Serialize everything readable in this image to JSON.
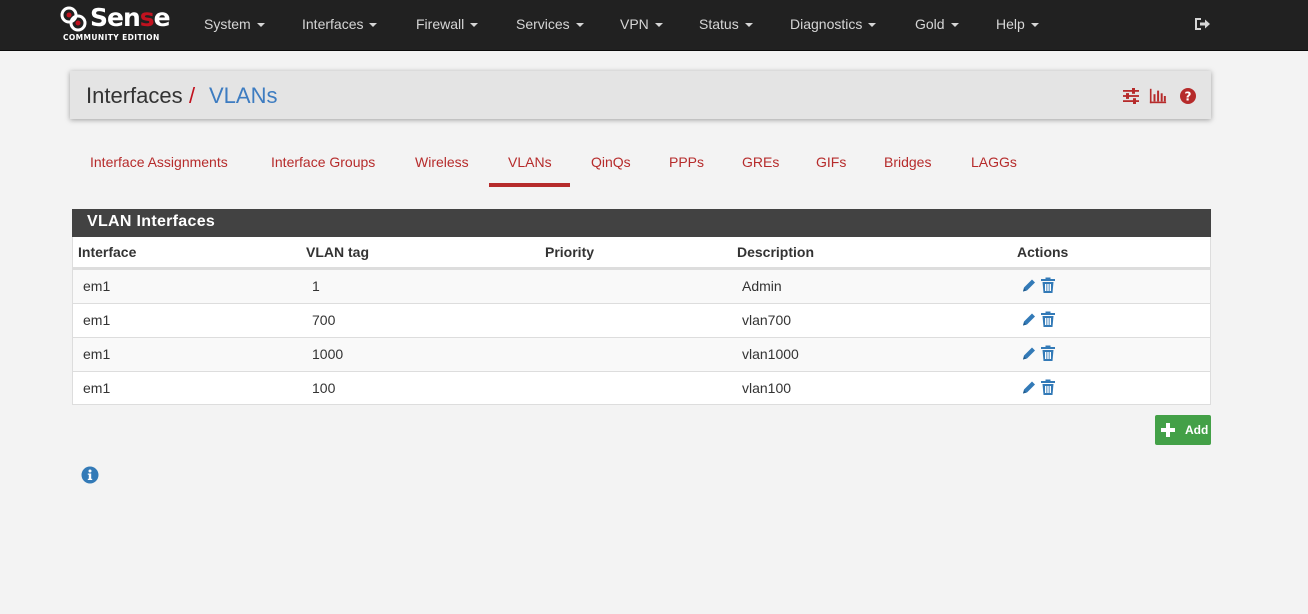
{
  "brand": {
    "name_prefix": "pf",
    "name_part1": "Sen",
    "name_part2": "s",
    "name_part3": "e",
    "edition": "COMMUNITY EDITION"
  },
  "nav": {
    "items": [
      {
        "label": "System"
      },
      {
        "label": "Interfaces"
      },
      {
        "label": "Firewall"
      },
      {
        "label": "Services"
      },
      {
        "label": "VPN"
      },
      {
        "label": "Status"
      },
      {
        "label": "Diagnostics"
      },
      {
        "label": "Gold"
      },
      {
        "label": "Help"
      }
    ],
    "logout_icon": "sign-out-icon"
  },
  "breadcrumb": {
    "root": "Interfaces",
    "separator": "/",
    "current": "VLANs"
  },
  "header_icons": [
    "sliders-icon",
    "bar-chart-icon",
    "question-circle-icon"
  ],
  "tabs": [
    {
      "label": "Interface Assignments",
      "active": false
    },
    {
      "label": "Interface Groups",
      "active": false
    },
    {
      "label": "Wireless",
      "active": false
    },
    {
      "label": "VLANs",
      "active": true
    },
    {
      "label": "QinQs",
      "active": false
    },
    {
      "label": "PPPs",
      "active": false
    },
    {
      "label": "GREs",
      "active": false
    },
    {
      "label": "GIFs",
      "active": false
    },
    {
      "label": "Bridges",
      "active": false
    },
    {
      "label": "LAGGs",
      "active": false
    }
  ],
  "panel": {
    "title": "VLAN Interfaces",
    "columns": [
      "Interface",
      "VLAN tag",
      "Priority",
      "Description",
      "Actions"
    ],
    "rows": [
      {
        "interface": "em1",
        "tag": "1",
        "priority": "",
        "description": "Admin"
      },
      {
        "interface": "em1",
        "tag": "700",
        "priority": "",
        "description": "vlan700"
      },
      {
        "interface": "em1",
        "tag": "1000",
        "priority": "",
        "description": "vlan1000"
      },
      {
        "interface": "em1",
        "tag": "100",
        "priority": "",
        "description": "vlan100"
      }
    ],
    "row_actions": [
      "pencil-icon",
      "trash-icon"
    ]
  },
  "add_button": {
    "label": "Add",
    "icon": "plus-icon"
  },
  "info_icon": "info-circle-icon",
  "colors": {
    "navbar": "#212121",
    "brand_red": "#c1121f",
    "tab_red": "#b62b2b",
    "link_blue": "#3d7cc1",
    "panel_header": "#424242",
    "success_green": "#43a047"
  }
}
